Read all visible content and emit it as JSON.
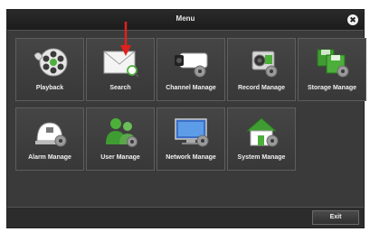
{
  "window": {
    "title": "Menu",
    "close_glyph": "✖"
  },
  "tiles": [
    {
      "label": "Playback",
      "icon": "film-reel-icon"
    },
    {
      "label": "Search",
      "icon": "envelope-search-icon"
    },
    {
      "label": "Channel Manage",
      "icon": "camera-gear-icon"
    },
    {
      "label": "Record Manage",
      "icon": "camcorder-gear-icon"
    },
    {
      "label": "Storage Manage",
      "icon": "floppy-disk-gear-icon"
    },
    {
      "label": "Alarm Manage",
      "icon": "alarm-gear-icon"
    },
    {
      "label": "User Manage",
      "icon": "users-gear-icon"
    },
    {
      "label": "Network Manage",
      "icon": "monitor-gear-icon"
    },
    {
      "label": "System Manage",
      "icon": "house-gear-icon"
    }
  ],
  "footer": {
    "exit_label": "Exit"
  },
  "colors": {
    "arrow": "#e0201b",
    "gear": "#9a9a9a",
    "green": "#4caf3a"
  }
}
